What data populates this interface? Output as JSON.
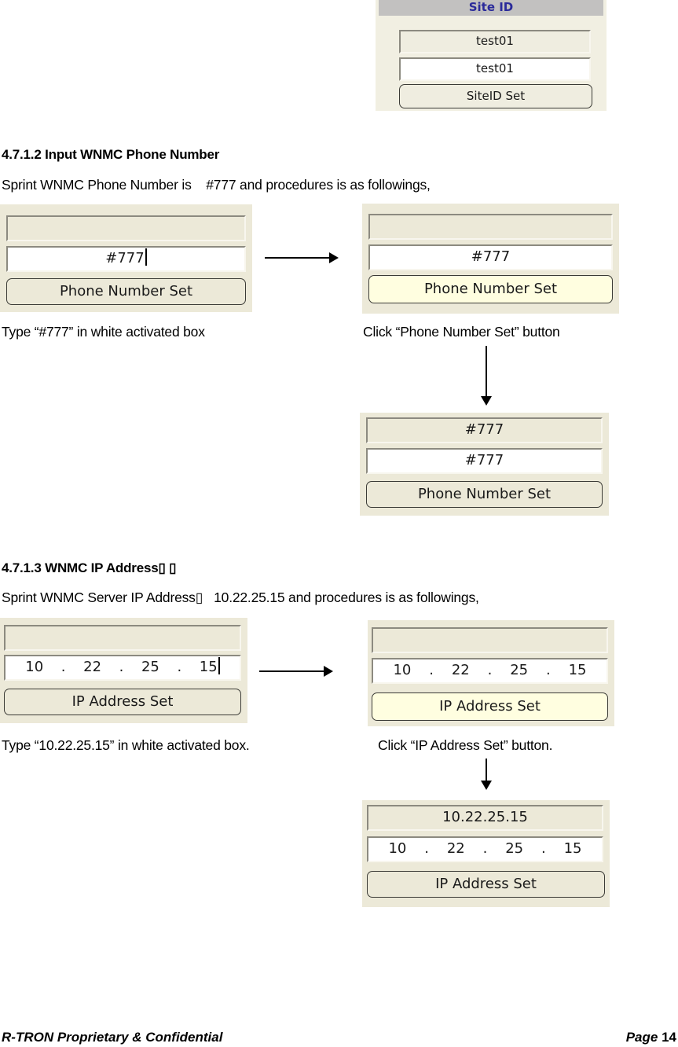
{
  "site_id_panel": {
    "header": "Site ID",
    "display_value": "test01",
    "input_value": "test01",
    "button_label": "SiteID Set"
  },
  "phone_section": {
    "heading": "4.7.1.2 Input WNMC Phone Number",
    "intro": "Sprint WNMC Phone Number is    #777 and procedures is as followings,",
    "step1": {
      "display_value": "",
      "input_value": "#777",
      "button_label": "Phone Number Set",
      "caption": "Type “#777” in white activated box"
    },
    "step2": {
      "display_value": "",
      "input_value": "#777",
      "button_label": "Phone Number Set",
      "caption": "Click “Phone Number Set” button"
    },
    "step3": {
      "display_value": "#777",
      "input_value": "#777",
      "button_label": "Phone Number Set"
    }
  },
  "ip_section": {
    "heading": "4.7.1.3 WNMC IP Address▯ ▯",
    "intro": "Sprint WNMC Server IP Address▯   10.22.25.15 and procedures is as followings,",
    "step1": {
      "display_value": "",
      "octets": [
        "10",
        "22",
        "25",
        "15"
      ],
      "separator": ".",
      "button_label": "IP Address Set",
      "caption": "Type “10.22.25.15” in white activated box."
    },
    "step2": {
      "display_value": "",
      "octets": [
        "10",
        "22",
        "25",
        "15"
      ],
      "separator": ".",
      "button_label": "IP Address Set",
      "caption": "Click “IP Address Set” button."
    },
    "step3": {
      "display_value": "10.22.25.15",
      "octets": [
        "10",
        "22",
        "25",
        "15"
      ],
      "separator": ".",
      "button_label": "IP Address Set"
    }
  },
  "footer": {
    "left": "R-TRON Proprietary & Confidential",
    "page_label": "Page",
    "page_number": "14"
  }
}
